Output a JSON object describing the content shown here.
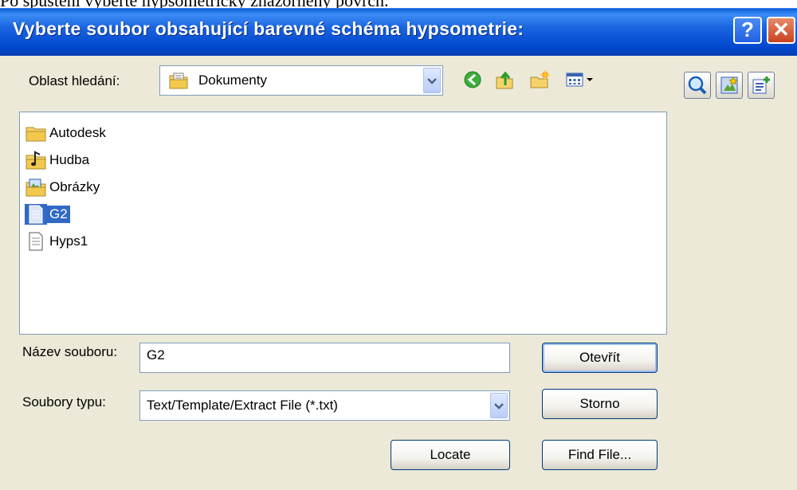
{
  "caption": "Po spuštění vyberte hypsometrický znázorněný povrch.",
  "window": {
    "title": "Vyberte soubor obsahující barevné schéma hypsometrie:",
    "help_label": "?",
    "close_label": "✕"
  },
  "lookin": {
    "label": "Oblast hledání:",
    "value": "Dokumenty"
  },
  "toolbar": {
    "icons": [
      "back-icon",
      "up-folder-icon",
      "new-folder-icon",
      "view-menu-icon"
    ]
  },
  "right_tools": {
    "icons": [
      "search-icon",
      "favorites-icon",
      "add-favorite-icon"
    ]
  },
  "files": [
    {
      "name": "Autodesk",
      "type": "folder"
    },
    {
      "name": "Hudba",
      "type": "music-folder"
    },
    {
      "name": "Obrázky",
      "type": "pictures-folder"
    },
    {
      "name": "G2",
      "type": "text-file",
      "selected": true
    },
    {
      "name": "Hyps1",
      "type": "text-file"
    }
  ],
  "filename": {
    "label": "Název souboru:",
    "value": "G2"
  },
  "filetype": {
    "label": "Soubory typu:",
    "value": "Text/Template/Extract File (*.txt)"
  },
  "buttons": {
    "open": "Otevřít",
    "cancel": "Storno",
    "locate": "Locate",
    "find_file": "Find File..."
  },
  "colors": {
    "titlebar": "#0a5fd8",
    "dialog_bg": "#ece9d8",
    "selection": "#316ac5"
  }
}
